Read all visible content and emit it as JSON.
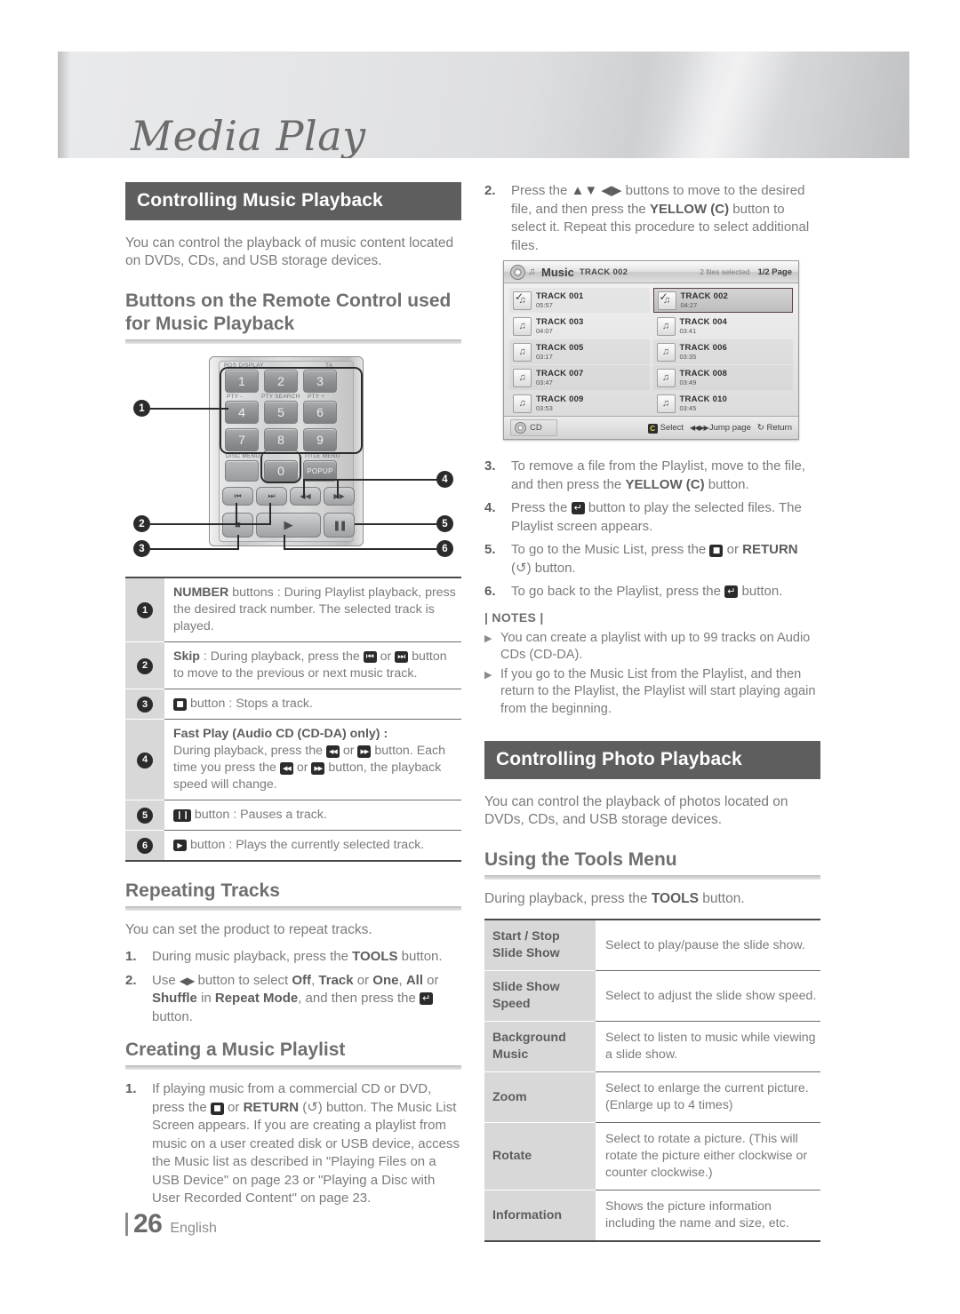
{
  "banner": {
    "title": "Media Play"
  },
  "left": {
    "section_bar": "Controlling Music Playback",
    "intro": "You can control the playback of music content located on DVDs, CDs, and USB storage devices.",
    "sub_heading": "Buttons on the Remote Control used for Music Playback",
    "remote": {
      "labels": {
        "rds_display": "RDS DISPLAY",
        "ta": "TA",
        "pty_minus": "PTY -",
        "pty_search": "PTY SEARCH",
        "pty_plus": "PTY +",
        "disc_menu": "DISC MENU",
        "title_menu": "TITLE MENU"
      },
      "keys": [
        "1",
        "2",
        "3",
        "4",
        "5",
        "6",
        "7",
        "8",
        "9",
        "0"
      ],
      "popup": "POPUP",
      "callouts": [
        "1",
        "2",
        "3",
        "4",
        "5",
        "6"
      ]
    },
    "button_table": [
      {
        "num": "1",
        "lead": "NUMBER",
        "rest": " buttons : During Playlist playback, press the desired track number. The selected track is played."
      },
      {
        "num": "2",
        "lead": "Skip",
        "rest": " : During playback, press the ",
        "rest2": " or ",
        "rest3": " button to move to the previous or next music track."
      },
      {
        "num": "3",
        "rest": " button : Stops a track."
      },
      {
        "num": "4",
        "lead": "Fast Play (Audio CD (CD-DA) only) :",
        "rest": "During playback, press the ",
        "rest2": " or ",
        "rest3": " button. Each time you press the ",
        "rest4": " or ",
        "rest5": " button, the playback speed will change."
      },
      {
        "num": "5",
        "rest": " button : Pauses a track."
      },
      {
        "num": "6",
        "rest": " button : Plays the currently selected track."
      }
    ],
    "repeating": {
      "heading": "Repeating Tracks",
      "intro": "You can set the product to repeat tracks.",
      "step1_n": "1.",
      "step1_a": "During music playback, press the ",
      "step1_b": "TOOLS",
      "step1_c": " button.",
      "step2_n": "2.",
      "step2_a": "Use ",
      "step2_b": " button to select ",
      "step2_off": "Off",
      "step2_sep1": ", ",
      "step2_track": "Track",
      "step2_or1": " or ",
      "step2_one": "One",
      "step2_sep2": ", ",
      "step2_all": "All",
      "step2_or2": " or ",
      "step2_shuffle": "Shuffle",
      "step2_in": " in ",
      "step2_mode": "Repeat Mode",
      "step2_end": ", and then press the ",
      "step2_tail": " button."
    },
    "playlist": {
      "heading": "Creating a Music Playlist",
      "step1_n": "1.",
      "step1_a": "If playing music from a commercial CD or DVD, press the ",
      "step1_b": " or ",
      "step1_return": "RETURN",
      "step1_paren": " (↺) button. The Music List Screen appears. If you are creating a playlist from music on a user created disk or USB device, access the Music list as described in \"Playing Files on a USB Device\" on page 23 or \"Playing a Disc with User Recorded Content\" on page 23."
    }
  },
  "right": {
    "step2_n": "2.",
    "step2_a": "Press the ",
    "step2_arrows": "▲▼ ◀▶",
    "step2_b": " buttons to move to the desired file, and then press the ",
    "step2_yellow": "YELLOW (C)",
    "step2_c": " button to select it. Repeat this procedure to select additional files.",
    "player": {
      "title": "Music",
      "subtitle": "TRACK 002",
      "files_selected": "2 files selected",
      "page": "1/2 Page",
      "source": "CD",
      "hint_select": "Select",
      "hint_select_key": "C",
      "hint_jump": "Jump page",
      "hint_return": "Return",
      "tracks": [
        {
          "name": "TRACK 001",
          "time": "05:57",
          "checked": true,
          "selected": false
        },
        {
          "name": "TRACK 002",
          "time": "04:27",
          "checked": true,
          "selected": true
        },
        {
          "name": "TRACK 003",
          "time": "04:07",
          "checked": false,
          "selected": false
        },
        {
          "name": "TRACK 004",
          "time": "03:41",
          "checked": false,
          "selected": false
        },
        {
          "name": "TRACK 005",
          "time": "03:17",
          "checked": false,
          "selected": false
        },
        {
          "name": "TRACK 006",
          "time": "03:35",
          "checked": false,
          "selected": false
        },
        {
          "name": "TRACK 007",
          "time": "03:47",
          "checked": false,
          "selected": false
        },
        {
          "name": "TRACK 008",
          "time": "03:49",
          "checked": false,
          "selected": false
        },
        {
          "name": "TRACK 009",
          "time": "03:53",
          "checked": false,
          "selected": false
        },
        {
          "name": "TRACK 010",
          "time": "03:45",
          "checked": false,
          "selected": false
        }
      ]
    },
    "step3_n": "3.",
    "step3_a": "To remove a file from the Playlist, move to the file, and then press the ",
    "step3_yellow": "YELLOW (C)",
    "step3_b": " button.",
    "step4_n": "4.",
    "step4_a": "Press the ",
    "step4_b": " button to play the selected files. The Playlist screen appears.",
    "step5_n": "5.",
    "step5_a": "To go to the Music List, press the ",
    "step5_b": " or ",
    "step5_return": "RETURN",
    "step5_c": " (↺) button.",
    "step6_n": "6.",
    "step6_a": "To go back to the Playlist, press the ",
    "step6_b": " button.",
    "notes_title": "| NOTES |",
    "notes": [
      "You can create a playlist with up to 99 tracks on Audio CDs (CD-DA).",
      "If you go to the Music List from the Playlist, and then return to the Playlist, the Playlist will start playing again from the beginning."
    ],
    "photo_bar": "Controlling Photo Playback",
    "photo_intro": "You can control the playback of photos located on DVDs, CDs, and USB storage devices.",
    "tools_heading": "Using the Tools Menu",
    "tools_intro_a": "During playback, press the ",
    "tools_intro_b": "TOOLS",
    "tools_intro_c": " button.",
    "tools_table": [
      {
        "key": "Start / Stop Slide Show",
        "value": "Select to play/pause the slide show."
      },
      {
        "key": "Slide Show Speed",
        "value": "Select to adjust the slide show speed."
      },
      {
        "key": "Background Music",
        "value": "Select to listen to music while viewing a slide show."
      },
      {
        "key": "Zoom",
        "value": "Select to enlarge the current picture. (Enlarge up to 4 times)"
      },
      {
        "key": "Rotate",
        "value": "Select to rotate a picture. (This will rotate the picture either clockwise or counter clockwise.)"
      },
      {
        "key": "Information",
        "value": "Shows the picture information including the name and size, etc."
      }
    ]
  },
  "footer": {
    "page": "26",
    "language": "English"
  }
}
